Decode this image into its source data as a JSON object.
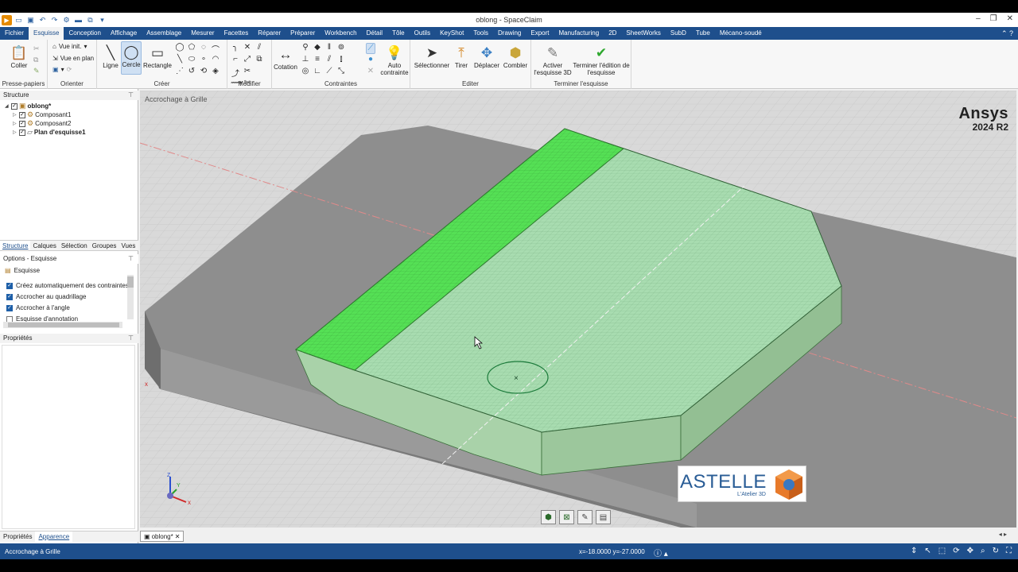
{
  "window": {
    "title": "oblong - SpaceClaim"
  },
  "menu": {
    "items": [
      "Fichier",
      "Esquisse",
      "Conception",
      "Affichage",
      "Assemblage",
      "Mesurer",
      "Facettes",
      "Réparer",
      "Préparer",
      "Workbench",
      "Détail",
      "Tôle",
      "Outils",
      "KeyShot",
      "Tools",
      "Drawing",
      "Export",
      "Manufacturing",
      "2D",
      "SheetWorks",
      "SubD",
      "Tube",
      "Mécano-soudé"
    ],
    "active": "Esquisse"
  },
  "ribbon": {
    "clipboard": {
      "paste": "Coller",
      "group": "Presse-papiers"
    },
    "orient": {
      "home": "Vue init.",
      "plan": "Vue en plan",
      "group": "Orienter"
    },
    "create": {
      "line": "Ligne",
      "circle": "Cercle",
      "rectangle": "Rectangle",
      "group": "Créer"
    },
    "modify": {
      "group": "Modifier"
    },
    "constraints": {
      "dimension": "Cotation",
      "auto": "Auto contrainte",
      "group": "Contraintes"
    },
    "edit": {
      "select": "Sélectionner",
      "pull": "Tirer",
      "move": "Déplacer",
      "fill": "Combler",
      "group": "Editer"
    },
    "finish": {
      "activate3d": "Activer l'esquisse 3D",
      "finish": "Terminer l'édition de l'esquisse",
      "group": "Terminer l'esquisse"
    }
  },
  "structure": {
    "header": "Structure",
    "root": "oblong*",
    "items": [
      "Composant1",
      "Composant2",
      "Plan d'esquisse1"
    ]
  },
  "paneltabs": [
    "Structure",
    "Calques",
    "Sélection",
    "Groupes",
    "Vues"
  ],
  "options": {
    "header": "Options - Esquisse",
    "section": "Esquisse",
    "items": [
      {
        "label": "Créez automatiquement des contraintes",
        "checked": true
      },
      {
        "label": "Accrocher au quadrillage",
        "checked": true
      },
      {
        "label": "Accrocher à l'angle",
        "checked": true
      },
      {
        "label": "Esquisse d'annotation",
        "checked": false
      }
    ]
  },
  "properties": {
    "header": "Propriétés"
  },
  "bottomtabs": [
    "Propriétés",
    "Apparence"
  ],
  "viewport": {
    "label": "Accrochage à Grille",
    "brand_line1": "Ansys",
    "brand_line2": "2024 R2",
    "axis_x": "x",
    "axis_y": "Y",
    "axis_z": "Z",
    "astelle_title": "ASTELLE",
    "astelle_sub": "L'Atelier 3D"
  },
  "doctab": {
    "label": "oblong*"
  },
  "status": {
    "text": "Accrochage à Grille",
    "coords": "x=-18.0000  y=-27.0000"
  },
  "colors": {
    "menu_bg": "#1e4f8c",
    "face_green": "#4fe04f",
    "sketch_green": "#9ed9a8"
  }
}
